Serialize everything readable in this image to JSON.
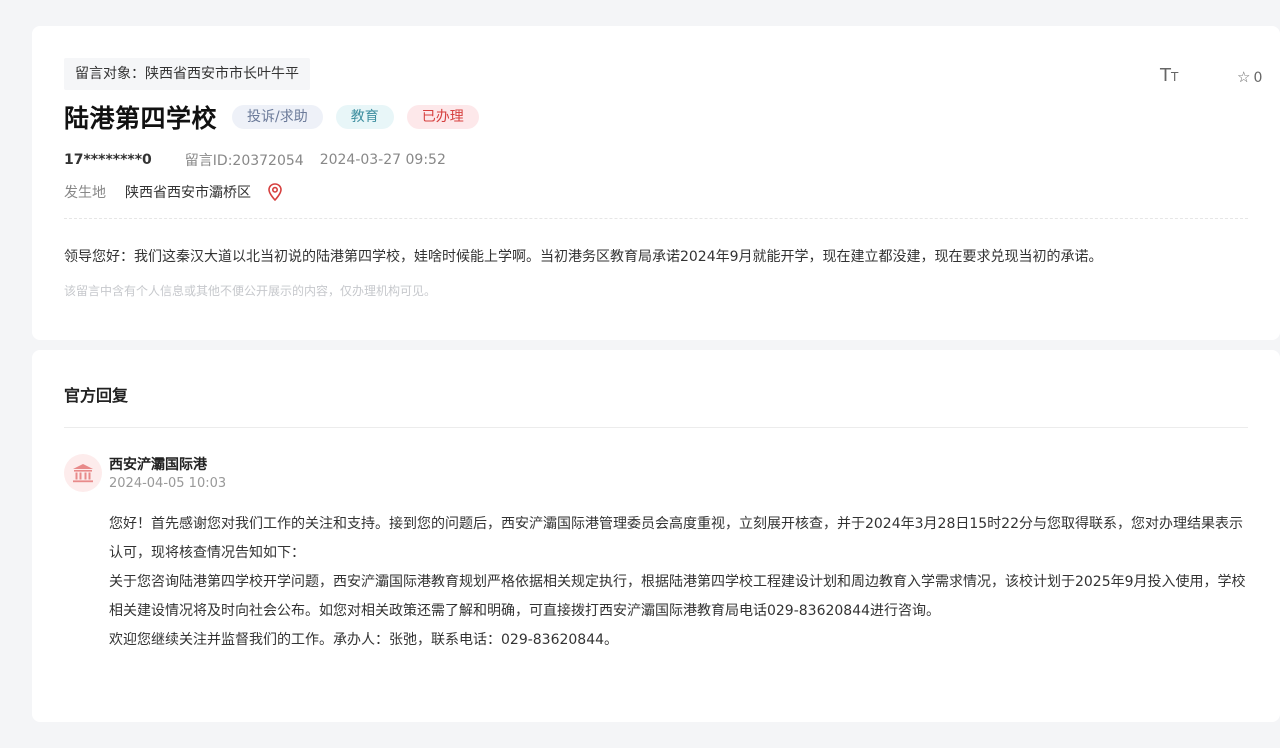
{
  "message": {
    "target": "留言对象：陕西省西安市市长叶牛平",
    "title": "陆港第四学校",
    "tags": {
      "type": "投诉/求助",
      "field": "教育",
      "status": "已办理"
    },
    "user": "17********0",
    "id": "留言ID:20372054",
    "time": "2024-03-27 09:52",
    "location_label": "发生地",
    "location": "陕西省西安市灞桥区",
    "content": "领导您好：我们这秦汉大道以北当初说的陆港第四学校，娃啥时候能上学啊。当初港务区教育局承诺2024年9月就能开学，现在建立都没建，现在要求兑现当初的承诺。",
    "privacy_notice": "该留言中含有个人信息或其他不便公开展示的内容，仅办理机构可见。"
  },
  "toolbar": {
    "font_icon_label_big": "T",
    "font_icon_label_small": "T",
    "favorite_count": "0"
  },
  "reply": {
    "section_title": "官方回复",
    "org": "西安浐灞国际港",
    "time": "2024-04-05 10:03",
    "paragraphs": [
      "您好！首先感谢您对我们工作的关注和支持。接到您的问题后，西安浐灞国际港管理委员会高度重视，立刻展开核查，并于2024年3月28日15时22分与您取得联系，您对办理结果表示认可，现将核查情况告知如下：",
      "关于您咨询陆港第四学校开学问题，西安浐灞国际港教育规划严格依据相关规定执行，根据陆港第四学校工程建设计划和周边教育入学需求情况，该校计划于2025年9月投入使用，学校相关建设情况将及时向社会公布。如您对相关政策还需了解和明确，可直接拨打西安浐灞国际港教育局电话029-83620844进行咨询。",
      "欢迎您继续关注并监督我们的工作。承办人：张弛，联系电话：029-83620844。"
    ]
  },
  "colors": {
    "status_red": "#d6403f",
    "avatar_icon": "#e88a8a"
  }
}
